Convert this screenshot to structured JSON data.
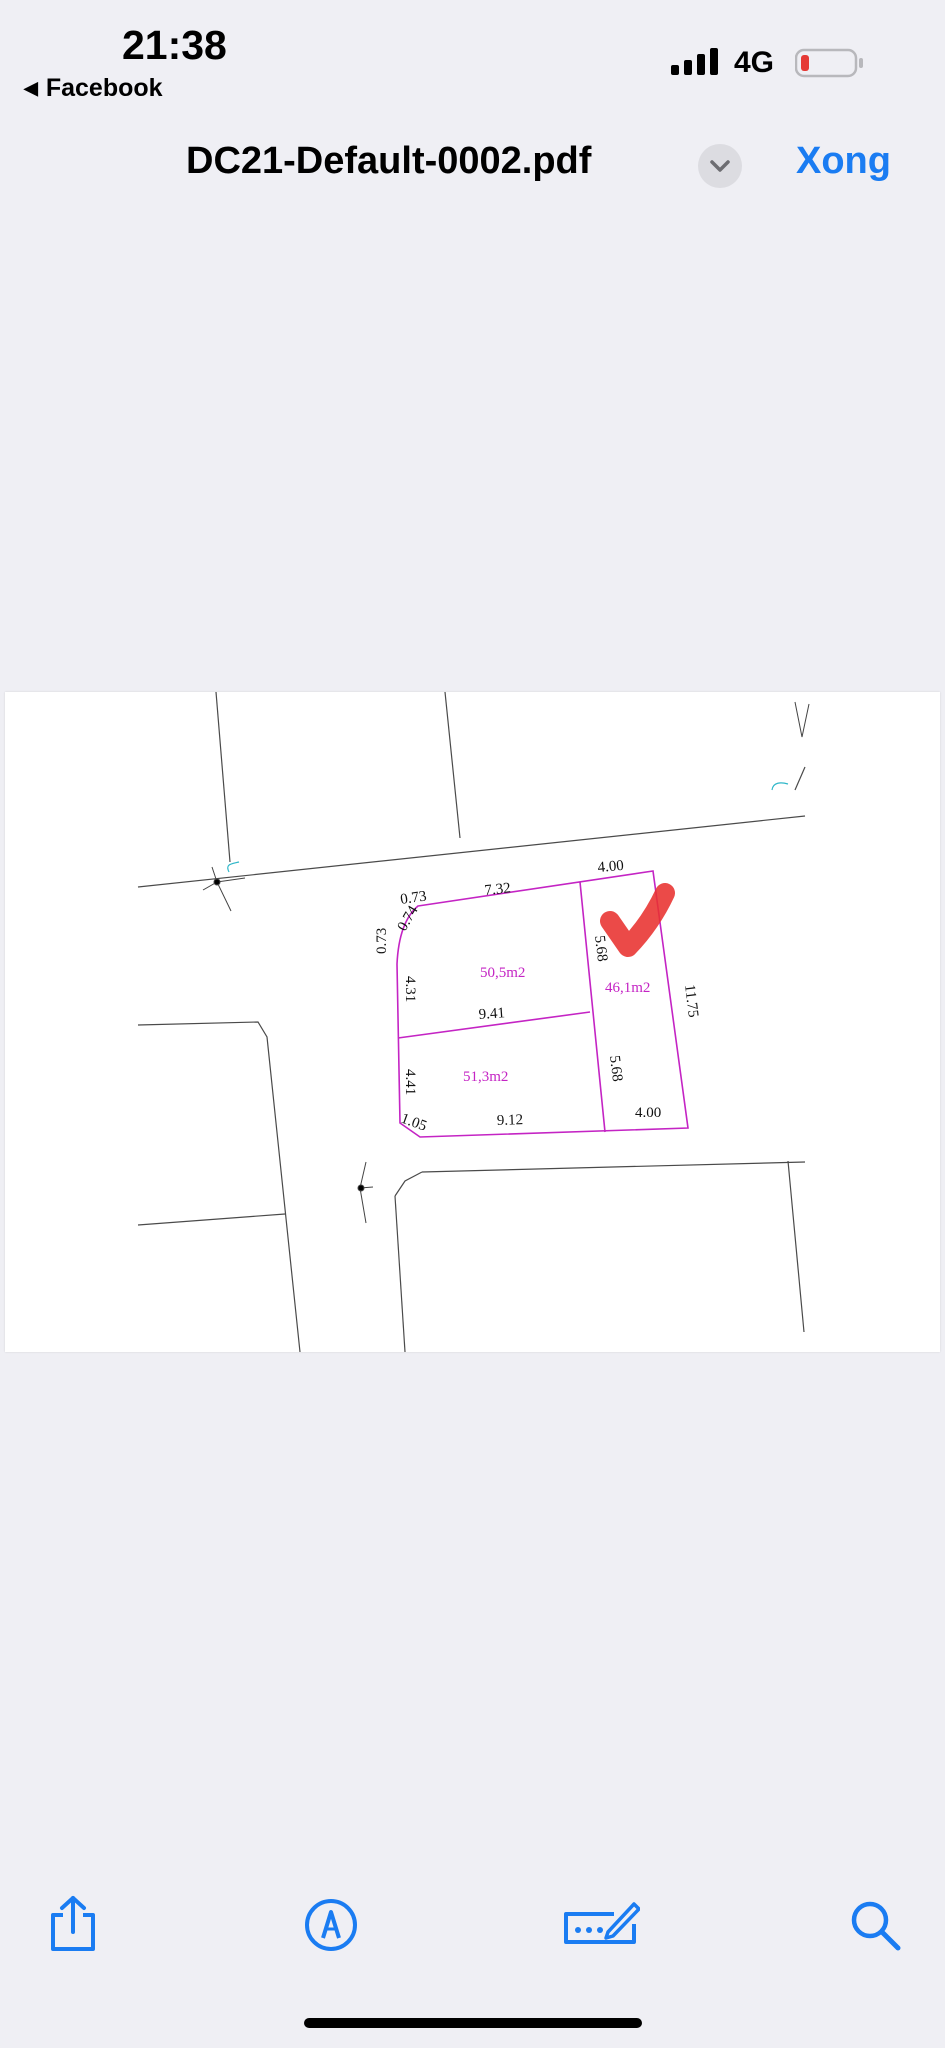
{
  "status_bar": {
    "time": "21:38",
    "back_app": "Facebook",
    "network": "4G"
  },
  "nav": {
    "title": "DC21-Default-0002.pdf",
    "done_label": "Xong"
  },
  "plan": {
    "dimensions": {
      "top_left_1": "0.73",
      "top_left_2": "0.74",
      "left_top_edge": "0.73",
      "top_edge": "7.32",
      "top_right_edge": "4.00",
      "left_upper": "4.31",
      "middle_divider": "9.41",
      "left_lower": "4.41",
      "bottom_corner": "1.05",
      "bottom_edge": "9.12",
      "bottom_right_edge": "4.00",
      "divider_upper": "5.68",
      "divider_lower": "5.68",
      "right_edge": "11.75"
    },
    "areas": {
      "plot_a": "50,5m2",
      "plot_b": "51,3m2",
      "plot_c": "46,1m2"
    }
  },
  "toolbar": {
    "share": "share-icon",
    "markup": "markup-pen-icon",
    "form": "form-fill-icon",
    "search": "search-icon"
  },
  "colors": {
    "accent": "#1a7cf2",
    "plot_lines": "#c424c4",
    "check_mark": "#e8312f",
    "battery_low": "#e53935"
  }
}
